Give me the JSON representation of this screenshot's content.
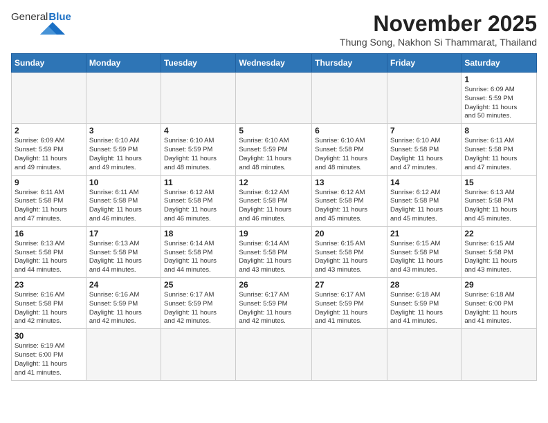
{
  "logo": {
    "general": "General",
    "blue": "Blue"
  },
  "header": {
    "month": "November 2025",
    "location": "Thung Song, Nakhon Si Thammarat, Thailand"
  },
  "weekdays": [
    "Sunday",
    "Monday",
    "Tuesday",
    "Wednesday",
    "Thursday",
    "Friday",
    "Saturday"
  ],
  "weeks": [
    [
      {
        "day": "",
        "content": ""
      },
      {
        "day": "",
        "content": ""
      },
      {
        "day": "",
        "content": ""
      },
      {
        "day": "",
        "content": ""
      },
      {
        "day": "",
        "content": ""
      },
      {
        "day": "",
        "content": ""
      },
      {
        "day": "1",
        "content": "Sunrise: 6:09 AM\nSunset: 5:59 PM\nDaylight: 11 hours\nand 50 minutes."
      }
    ],
    [
      {
        "day": "2",
        "content": "Sunrise: 6:09 AM\nSunset: 5:59 PM\nDaylight: 11 hours\nand 49 minutes."
      },
      {
        "day": "3",
        "content": "Sunrise: 6:10 AM\nSunset: 5:59 PM\nDaylight: 11 hours\nand 49 minutes."
      },
      {
        "day": "4",
        "content": "Sunrise: 6:10 AM\nSunset: 5:59 PM\nDaylight: 11 hours\nand 48 minutes."
      },
      {
        "day": "5",
        "content": "Sunrise: 6:10 AM\nSunset: 5:59 PM\nDaylight: 11 hours\nand 48 minutes."
      },
      {
        "day": "6",
        "content": "Sunrise: 6:10 AM\nSunset: 5:58 PM\nDaylight: 11 hours\nand 48 minutes."
      },
      {
        "day": "7",
        "content": "Sunrise: 6:10 AM\nSunset: 5:58 PM\nDaylight: 11 hours\nand 47 minutes."
      },
      {
        "day": "8",
        "content": "Sunrise: 6:11 AM\nSunset: 5:58 PM\nDaylight: 11 hours\nand 47 minutes."
      }
    ],
    [
      {
        "day": "9",
        "content": "Sunrise: 6:11 AM\nSunset: 5:58 PM\nDaylight: 11 hours\nand 47 minutes."
      },
      {
        "day": "10",
        "content": "Sunrise: 6:11 AM\nSunset: 5:58 PM\nDaylight: 11 hours\nand 46 minutes."
      },
      {
        "day": "11",
        "content": "Sunrise: 6:12 AM\nSunset: 5:58 PM\nDaylight: 11 hours\nand 46 minutes."
      },
      {
        "day": "12",
        "content": "Sunrise: 6:12 AM\nSunset: 5:58 PM\nDaylight: 11 hours\nand 46 minutes."
      },
      {
        "day": "13",
        "content": "Sunrise: 6:12 AM\nSunset: 5:58 PM\nDaylight: 11 hours\nand 45 minutes."
      },
      {
        "day": "14",
        "content": "Sunrise: 6:12 AM\nSunset: 5:58 PM\nDaylight: 11 hours\nand 45 minutes."
      },
      {
        "day": "15",
        "content": "Sunrise: 6:13 AM\nSunset: 5:58 PM\nDaylight: 11 hours\nand 45 minutes."
      }
    ],
    [
      {
        "day": "16",
        "content": "Sunrise: 6:13 AM\nSunset: 5:58 PM\nDaylight: 11 hours\nand 44 minutes."
      },
      {
        "day": "17",
        "content": "Sunrise: 6:13 AM\nSunset: 5:58 PM\nDaylight: 11 hours\nand 44 minutes."
      },
      {
        "day": "18",
        "content": "Sunrise: 6:14 AM\nSunset: 5:58 PM\nDaylight: 11 hours\nand 44 minutes."
      },
      {
        "day": "19",
        "content": "Sunrise: 6:14 AM\nSunset: 5:58 PM\nDaylight: 11 hours\nand 43 minutes."
      },
      {
        "day": "20",
        "content": "Sunrise: 6:15 AM\nSunset: 5:58 PM\nDaylight: 11 hours\nand 43 minutes."
      },
      {
        "day": "21",
        "content": "Sunrise: 6:15 AM\nSunset: 5:58 PM\nDaylight: 11 hours\nand 43 minutes."
      },
      {
        "day": "22",
        "content": "Sunrise: 6:15 AM\nSunset: 5:58 PM\nDaylight: 11 hours\nand 43 minutes."
      }
    ],
    [
      {
        "day": "23",
        "content": "Sunrise: 6:16 AM\nSunset: 5:58 PM\nDaylight: 11 hours\nand 42 minutes."
      },
      {
        "day": "24",
        "content": "Sunrise: 6:16 AM\nSunset: 5:59 PM\nDaylight: 11 hours\nand 42 minutes."
      },
      {
        "day": "25",
        "content": "Sunrise: 6:17 AM\nSunset: 5:59 PM\nDaylight: 11 hours\nand 42 minutes."
      },
      {
        "day": "26",
        "content": "Sunrise: 6:17 AM\nSunset: 5:59 PM\nDaylight: 11 hours\nand 42 minutes."
      },
      {
        "day": "27",
        "content": "Sunrise: 6:17 AM\nSunset: 5:59 PM\nDaylight: 11 hours\nand 41 minutes."
      },
      {
        "day": "28",
        "content": "Sunrise: 6:18 AM\nSunset: 5:59 PM\nDaylight: 11 hours\nand 41 minutes."
      },
      {
        "day": "29",
        "content": "Sunrise: 6:18 AM\nSunset: 6:00 PM\nDaylight: 11 hours\nand 41 minutes."
      }
    ],
    [
      {
        "day": "30",
        "content": "Sunrise: 6:19 AM\nSunset: 6:00 PM\nDaylight: 11 hours\nand 41 minutes."
      },
      {
        "day": "",
        "content": ""
      },
      {
        "day": "",
        "content": ""
      },
      {
        "day": "",
        "content": ""
      },
      {
        "day": "",
        "content": ""
      },
      {
        "day": "",
        "content": ""
      },
      {
        "day": "",
        "content": ""
      }
    ]
  ]
}
